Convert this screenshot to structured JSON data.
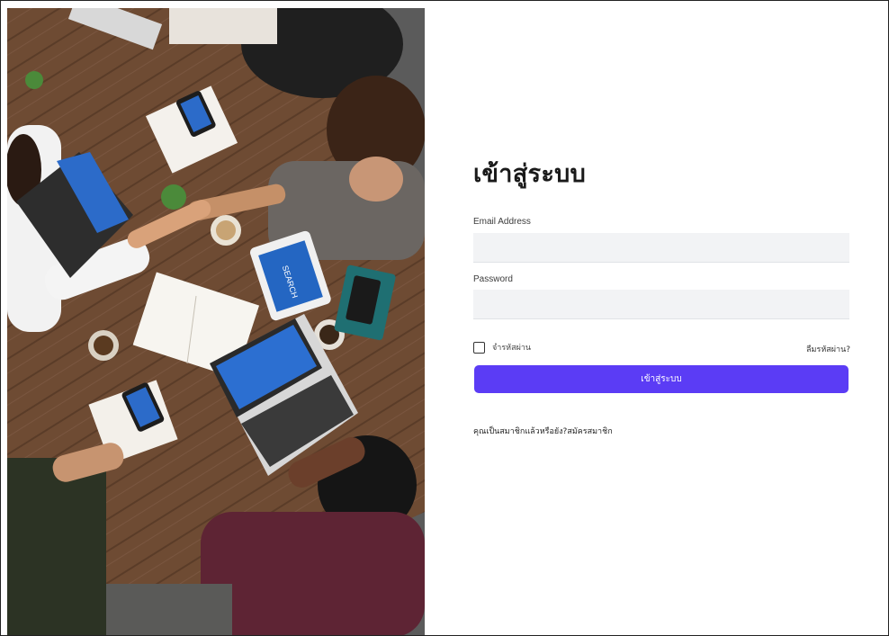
{
  "login": {
    "title": "เข้าสู่ระบบ",
    "email_label": "Email Address",
    "email_value": "",
    "password_label": "Password",
    "password_value": "",
    "remember_label": "จำรหัสผ่าน",
    "forgot_label": "ลืมรหัสผ่าน?",
    "submit_label": "เข้าสู่ระบบ",
    "signup_prompt": "คุณเป็นสมาชิกแล้วหรือยัง?",
    "signup_link": "สมัครสมาชิก"
  },
  "colors": {
    "accent": "#5b3cf5",
    "input_bg": "#f2f3f5",
    "table_wood": "#6b4a33"
  },
  "photo": {
    "screen_text": "SEARCH"
  }
}
